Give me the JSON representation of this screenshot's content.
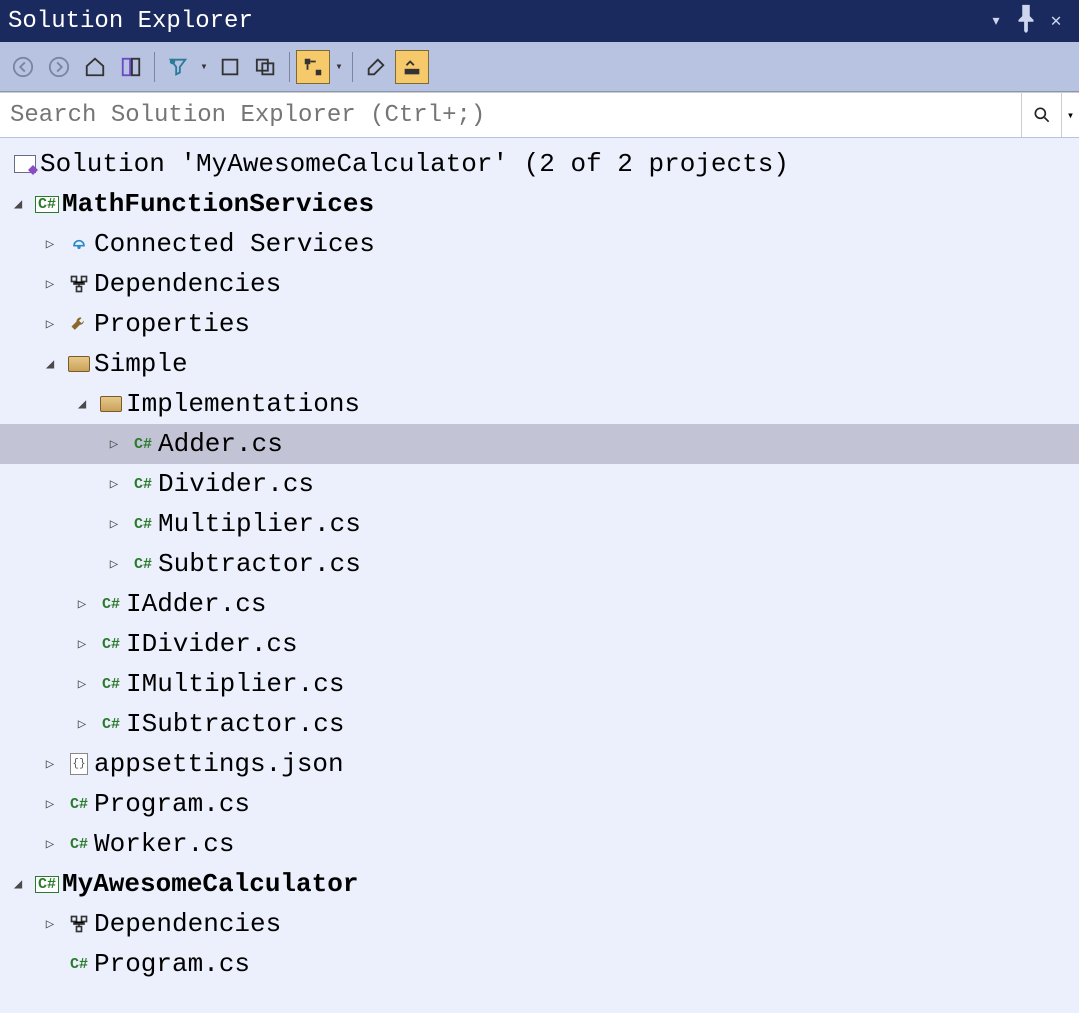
{
  "title": "Solution Explorer",
  "search_placeholder": "Search Solution Explorer (Ctrl+;)",
  "solution_label": "Solution 'MyAwesomeCalculator' (2 of 2 projects)",
  "tree": {
    "proj1": {
      "name": "MathFunctionServices",
      "connected": "Connected Services",
      "dependencies": "Dependencies",
      "properties": "Properties",
      "simple": "Simple",
      "implementations": "Implementations",
      "files": {
        "adder": "Adder.cs",
        "divider": "Divider.cs",
        "multiplier": "Multiplier.cs",
        "subtractor": "Subtractor.cs",
        "iadder": "IAdder.cs",
        "idivider": "IDivider.cs",
        "imultiplier": "IMultiplier.cs",
        "isubtractor": "ISubtractor.cs",
        "appsettings": "appsettings.json",
        "program": "Program.cs",
        "worker": "Worker.cs"
      }
    },
    "proj2": {
      "name": "MyAwesomeCalculator",
      "dependencies": "Dependencies",
      "program": "Program.cs"
    }
  },
  "selected_file": "Adder.cs"
}
